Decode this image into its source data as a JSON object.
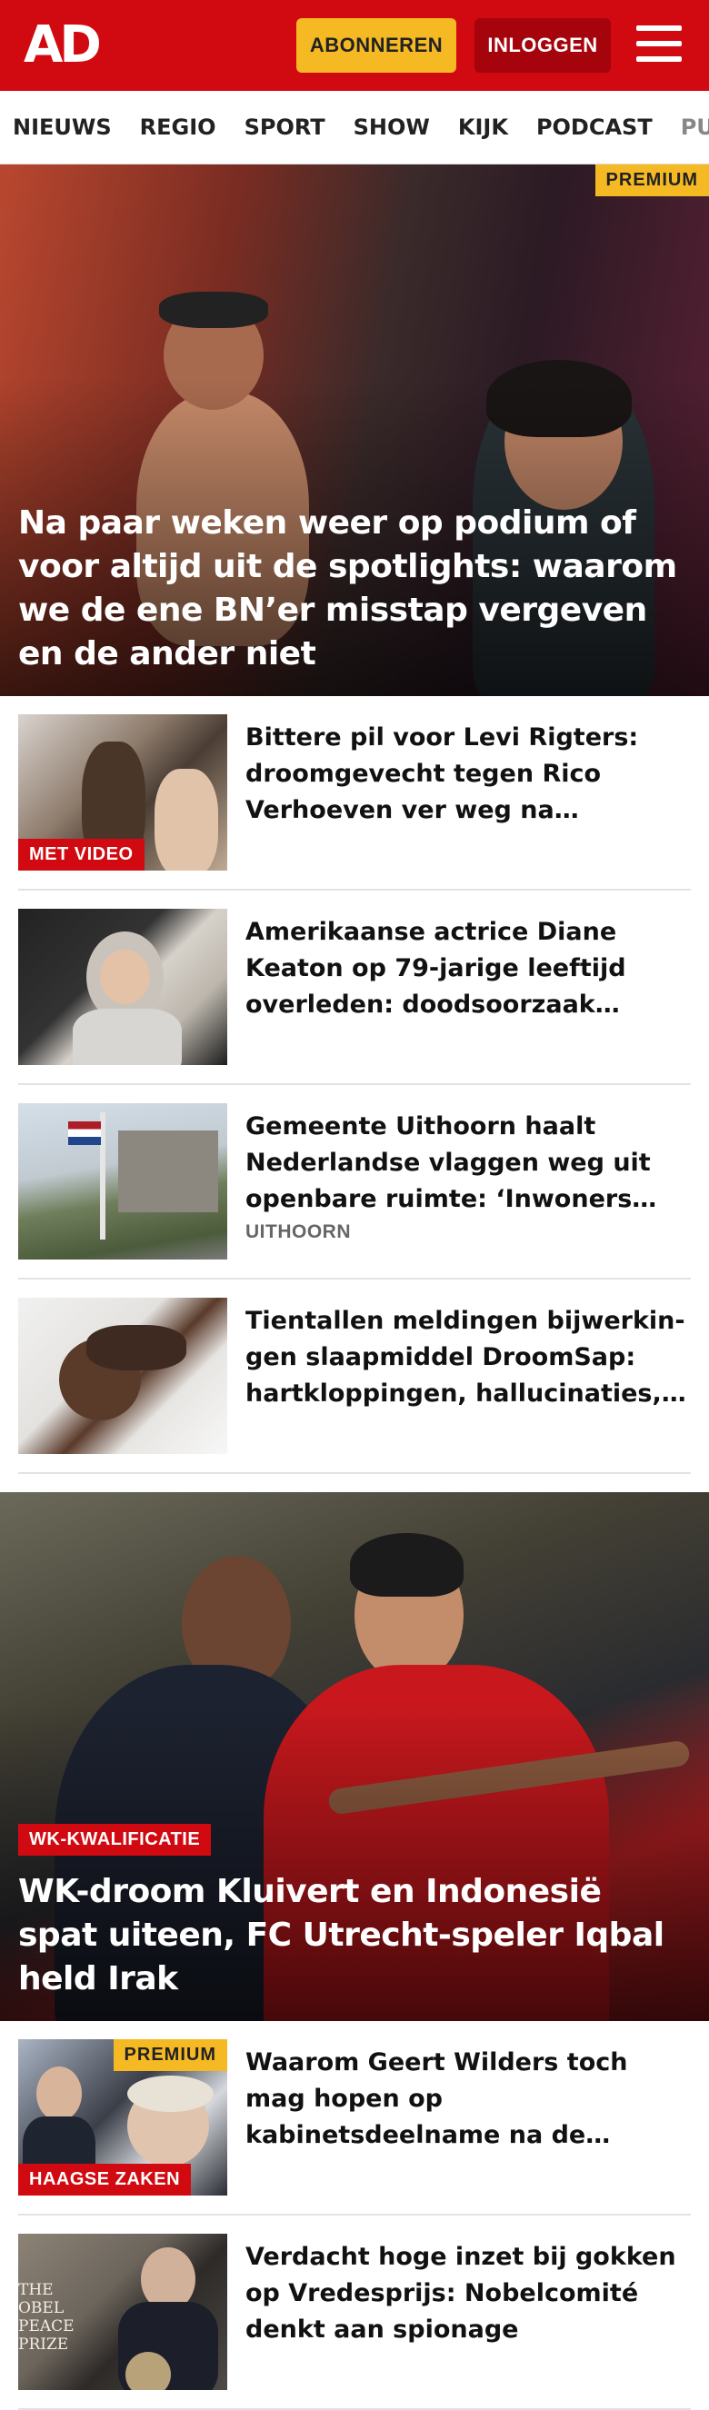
{
  "header": {
    "logo": "AD",
    "subscribe_label": "ABONNEREN",
    "login_label": "INLOGGEN",
    "menu_icon": "hamburger-menu-icon",
    "brand_color": "#d10a11",
    "accent_color": "#f5b924"
  },
  "nav": {
    "items": [
      "NIEUWS",
      "REGIO",
      "SPORT",
      "SHOW",
      "KIJK",
      "PODCAST",
      "PUZZ"
    ]
  },
  "hero1": {
    "badge": "PREMIUM",
    "title": "Na paar weken weer op podium of voor altijd uit de spotlights: waarom we de ene BN’er misstap vergeven en de ander niet"
  },
  "articles1": [
    {
      "title": "Bittere pil voor Levi Rigters: droomgevecht tegen Rico Verhoeven ver weg na pijnlijke…",
      "tag": "MET VIDEO"
    },
    {
      "title": "Amerikaanse actrice Diane Keaton op 79-jarige leeftijd overleden: doodsoorzaak…"
    },
    {
      "title": "Gemeente Uithoorn haalt Nederlandse vlaggen weg uit openbare ruimte: ‘Inwoners…",
      "label": "UITHOORN"
    },
    {
      "title": "Tientallen meldingen bijwerkin­gen slaapmiddel DroomSap: hartkloppingen, hallucinaties,…"
    }
  ],
  "hero2": {
    "tag": "WK-KWALIFICATIE",
    "title": "WK-droom Kluivert en Indonesië spat uiteen, FC Utrecht-speler Iqbal held Irak"
  },
  "articles2": [
    {
      "title": "Waarom Geert Wilders toch mag hopen op kabinetsdeelname na de verkiezingen",
      "tag": "HAAGSE ZAKEN",
      "badge": "PREMIUM"
    },
    {
      "title": "Verdacht hoge inzet bij gokken op Vredesprijs: Nobelcomité denkt aan spionage",
      "thumb_text": "THE\nOBEL\nPEACE\nPRIZE"
    }
  ]
}
